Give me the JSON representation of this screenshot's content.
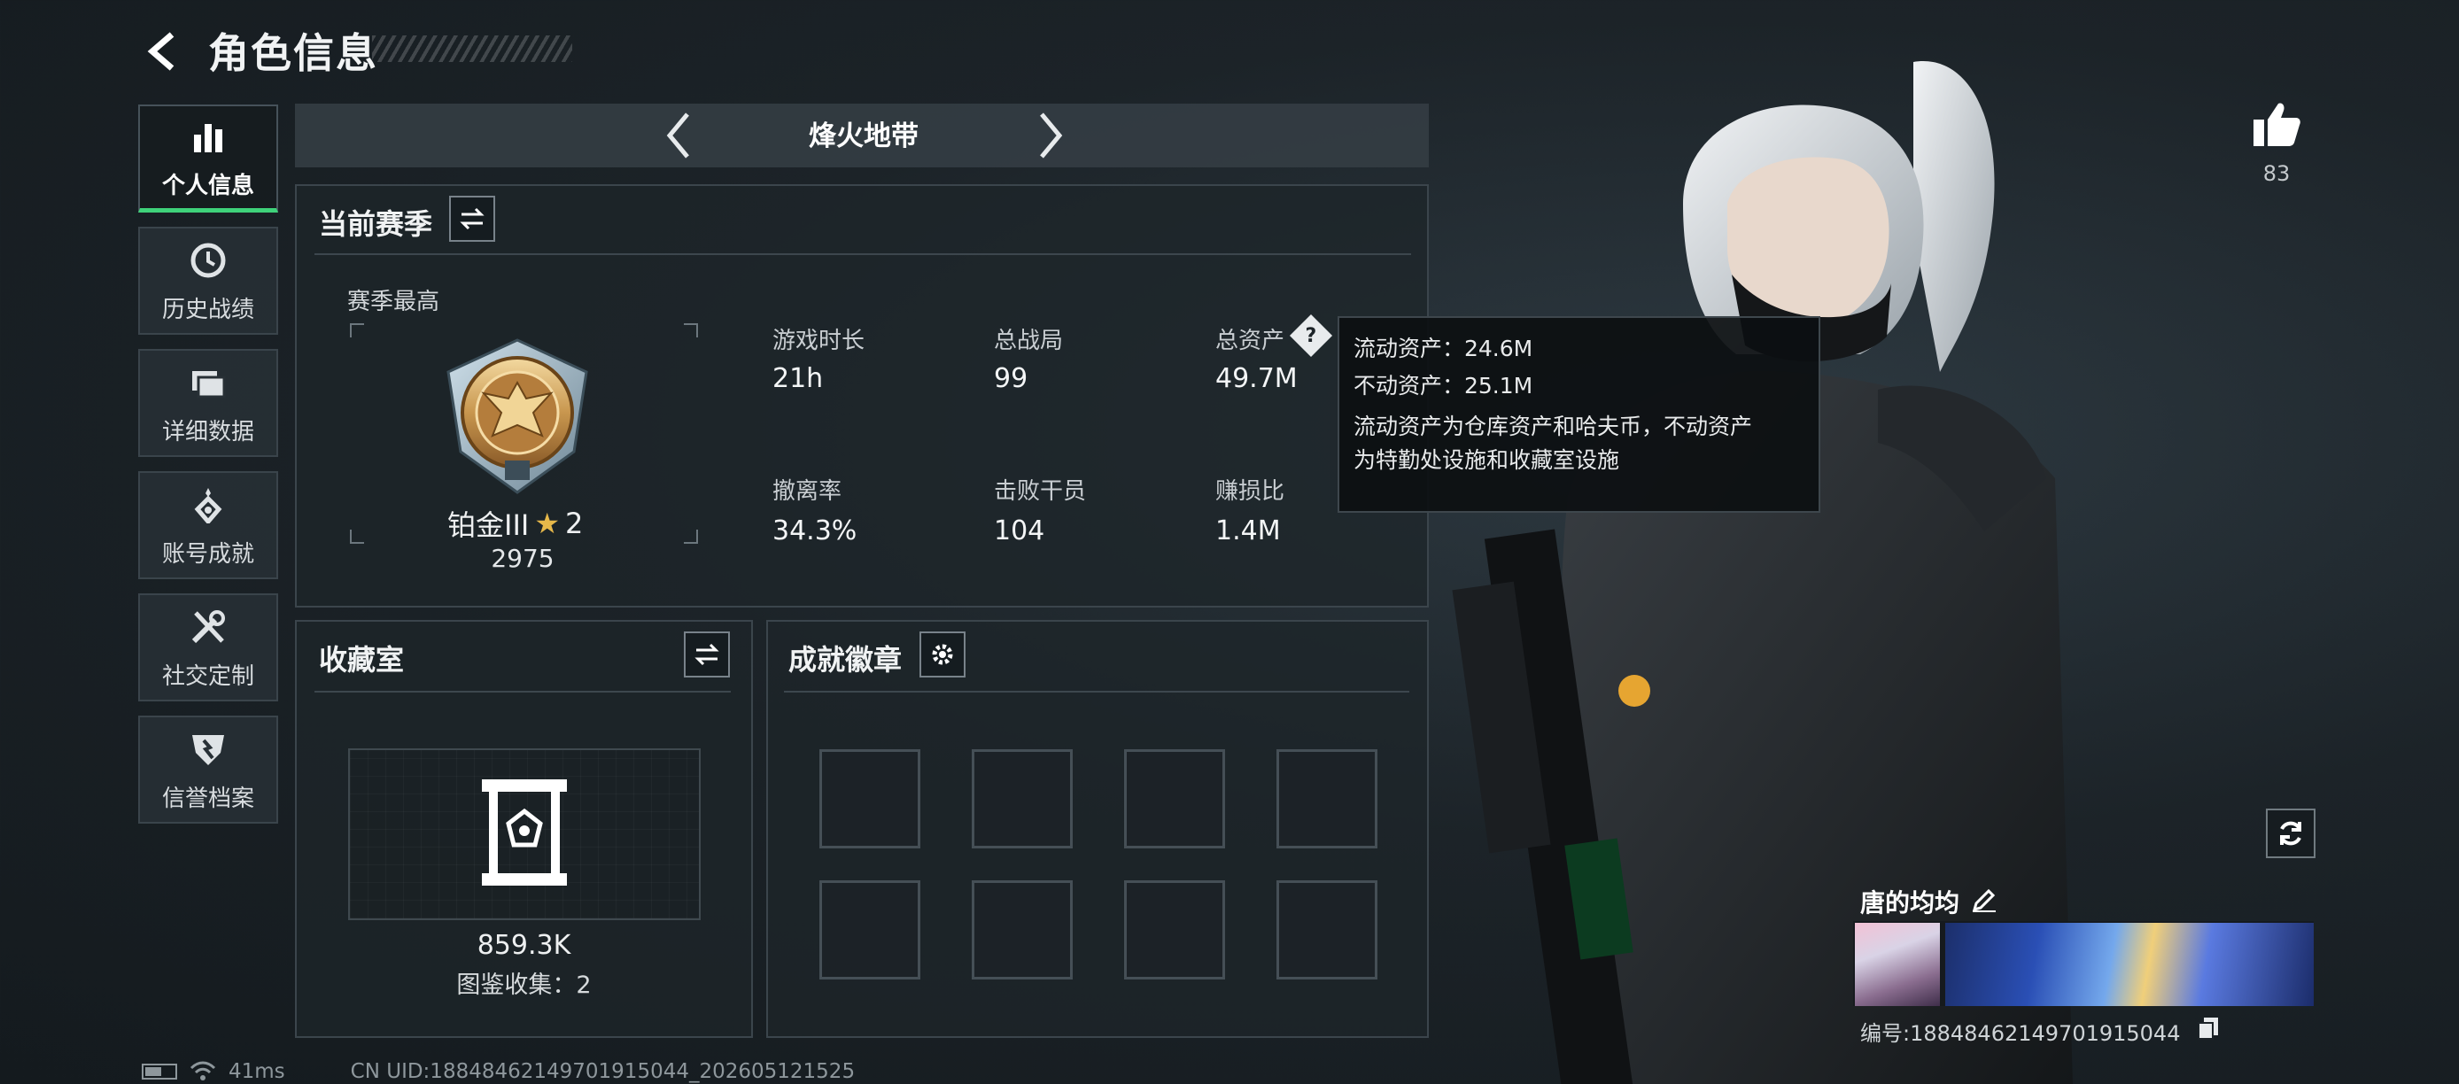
{
  "header": {
    "title": "角色信息"
  },
  "sidebar": {
    "items": [
      {
        "label": "个人信息",
        "icon": "bar-chart-icon",
        "active": true
      },
      {
        "label": "历史战绩",
        "icon": "clock-icon"
      },
      {
        "label": "详细数据",
        "icon": "folder-icon"
      },
      {
        "label": "账号成就",
        "icon": "medal-icon"
      },
      {
        "label": "社交定制",
        "icon": "tools-icon"
      },
      {
        "label": "信誉档案",
        "icon": "shield-icon"
      }
    ]
  },
  "mode": {
    "label": "烽火地带"
  },
  "season": {
    "title": "当前赛季",
    "best_label": "赛季最高",
    "rank_name": "铂金III",
    "rank_stars": "2",
    "rank_score": "2975",
    "stats": [
      {
        "label": "游戏时长",
        "value": "21h"
      },
      {
        "label": "总战局",
        "value": "99"
      },
      {
        "label": "总资产",
        "value": "49.7M"
      },
      {
        "label": "撤离率",
        "value": "34.3%"
      },
      {
        "label": "击败干员",
        "value": "104"
      },
      {
        "label": "赚损比",
        "value": "1.4M"
      }
    ]
  },
  "tooltip": {
    "liquid": "流动资产：24.6M",
    "fixed": "不动资产：25.1M",
    "desc_line1": "流动资产为仓库资产和哈夫币，不动资产",
    "desc_line2": "为特勤处设施和收藏室设施"
  },
  "collection": {
    "title": "收藏室",
    "value": "859.3K",
    "catalog": "图鉴收集：2"
  },
  "badges": {
    "title": "成就徽章"
  },
  "player": {
    "likes": "83",
    "name": "唐的均均",
    "id": "编号:18848462149701915044"
  },
  "status": {
    "ping": "41ms",
    "uid": "CN UID:18848462149701915044_202605121525"
  },
  "colors": {
    "accent": "#3fd27a",
    "background": "#1c2328",
    "panel": "#1e252a"
  }
}
